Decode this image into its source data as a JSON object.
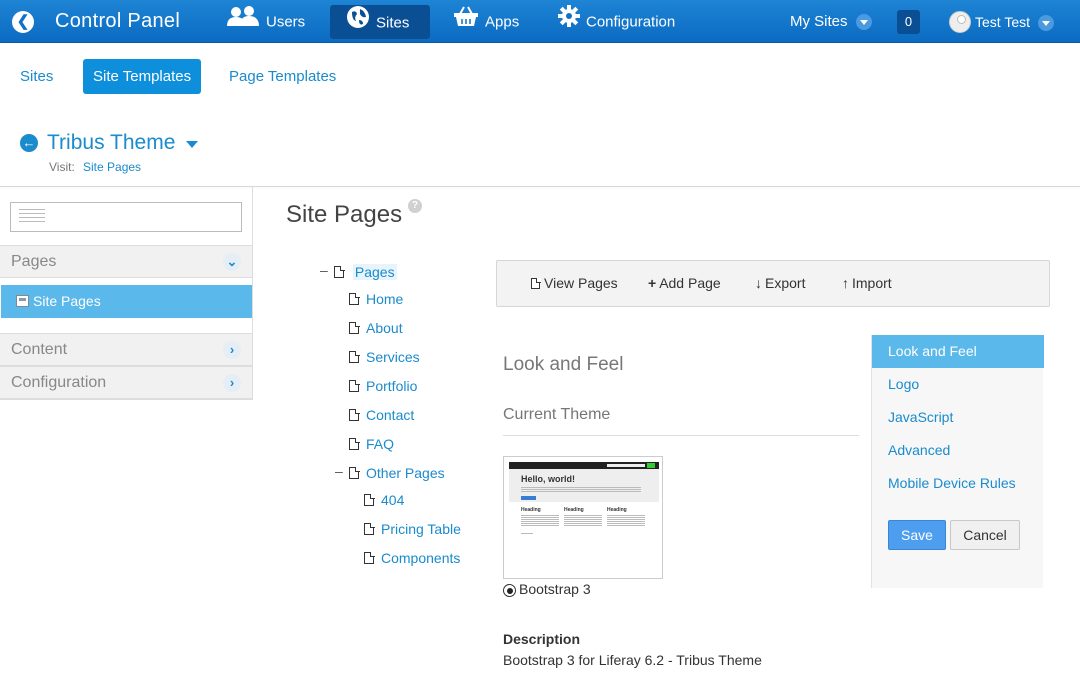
{
  "topbar": {
    "title": "Control Panel",
    "nav": [
      {
        "label": "Users",
        "icon": "users-icon"
      },
      {
        "label": "Sites",
        "icon": "globe-icon",
        "active": true
      },
      {
        "label": "Apps",
        "icon": "basket-icon"
      },
      {
        "label": "Configuration",
        "icon": "gear-icon"
      }
    ],
    "my_sites": "My Sites",
    "notifications": "0",
    "user": "Test Test"
  },
  "tabs": [
    "Sites",
    "Site Templates",
    "Page Templates"
  ],
  "site": {
    "title": "Tribus Theme",
    "visit_label": "Visit:",
    "visit_link": "Site Pages"
  },
  "sidebar": {
    "sections": [
      "Pages",
      "Content",
      "Configuration"
    ],
    "active_item": "Site Pages"
  },
  "main": {
    "heading": "Site Pages",
    "help": "?",
    "tree": {
      "root": "Pages",
      "children": [
        "Home",
        "About",
        "Services",
        "Portfolio",
        "Contact",
        "FAQ"
      ],
      "group": "Other Pages",
      "group_children": [
        "404",
        "Pricing Table",
        "Components"
      ]
    },
    "toolbar": [
      "View Pages",
      "Add Page",
      "Export",
      "Import"
    ],
    "section_title": "Look and Feel",
    "sub_title": "Current Theme",
    "theme_name": "Bootstrap 3",
    "thumb": {
      "hello": "Hello, world!",
      "col_heading": "Heading"
    },
    "description_label": "Description",
    "description": "Bootstrap 3 for Liferay 6.2 - Tribus Theme"
  },
  "right_panel": {
    "items": [
      "Look and Feel",
      "Logo",
      "JavaScript",
      "Advanced",
      "Mobile Device Rules"
    ],
    "save": "Save",
    "cancel": "Cancel"
  },
  "colors": {
    "topbar": "#0f72c8",
    "accent": "#1a8bcd",
    "active_item": "#5ab8ea"
  }
}
